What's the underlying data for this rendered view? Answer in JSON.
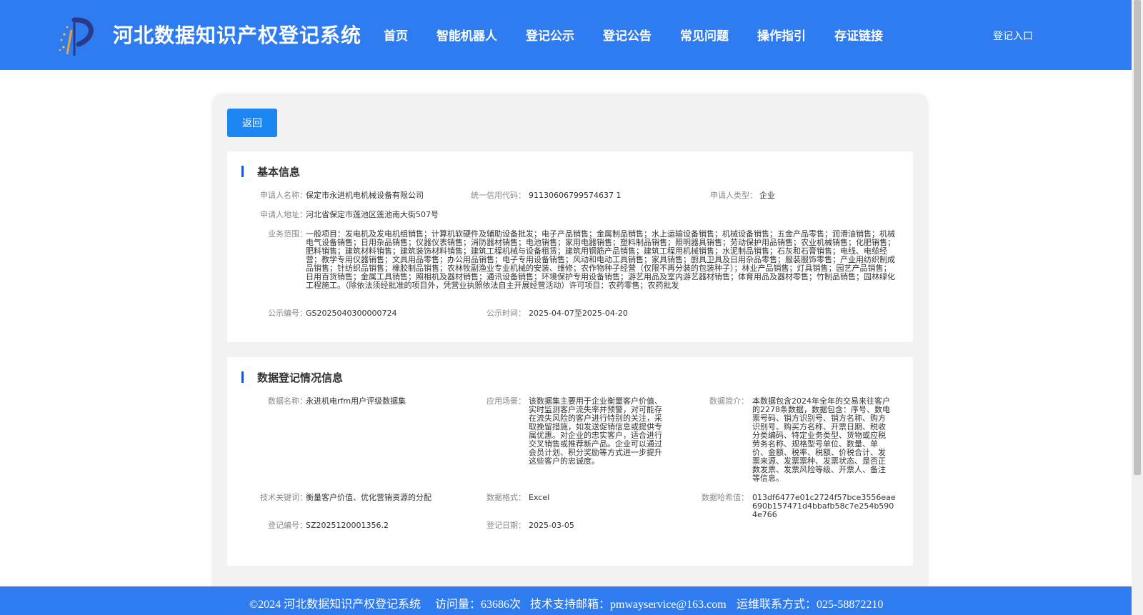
{
  "header": {
    "site_title": "河北数据知识产权登记系统",
    "nav": [
      "首页",
      "智能机器人",
      "登记公示",
      "登记公告",
      "常见问题",
      "操作指引",
      "存证链接"
    ],
    "login": "登记入口",
    "colors": {
      "header_bg": "#2f7bf0",
      "button": "#1e86f2",
      "section_accent": "#1e56c8"
    }
  },
  "toolbar": {
    "back_label": "返回"
  },
  "basic_info": {
    "title": "基本信息",
    "applicant_name": {
      "label": "申请人名称：",
      "value": "保定市永进机电机械设备有限公司"
    },
    "credit_code": {
      "label": "统一信用代码：",
      "value": "91130606799574637 1"
    },
    "applicant_type": {
      "label": "申请人类型：",
      "value": "企业"
    },
    "address": {
      "label": "申请人地址：",
      "value": "河北省保定市莲池区莲池南大街507号"
    },
    "business_scope": {
      "label": "业务范围：",
      "value": "一般项目：发电机及发电机组销售；计算机软硬件及辅助设备批发；电子产品销售；金属制品销售；水上运输设备销售；机械设备销售；五金产品零售；润滑油销售；机械电气设备销售；日用杂品销售；仪器仪表销售；消防器材销售；电池销售；家用电器销售；塑料制品销售；照明器具销售；劳动保护用品销售；农业机械销售；化肥销售；肥料销售；建筑材料销售；建筑装饰材料销售；建筑工程机械与设备租赁；建筑用钢筋产品销售；建筑工程用机械销售；水泥制品销售；石灰和石膏销售；电线、电缆经营；教学专用仪器销售；文具用品零售；办公用品销售；电子专用设备销售；风动和电动工具销售；家具销售；厨具卫具及日用杂品零售；服装服饰零售；产业用纺织制成品销售；针纺织品销售；橡胶制品销售；农林牧副渔业专业机械的安装、维修；农作物种子经营（仅限不再分装的包装种子）；林业产品销售；灯具销售；园艺产品销售；日用百货销售；金属工具销售；照相机及器材销售；通讯设备销售；环境保护专用设备销售；游艺用品及室内游艺器材销售；体育用品及器材零售；竹制品销售；园林绿化工程施工。（除依法须经批准的项目外，凭营业执照依法自主开展经营活动）许可项目：农药零售；农药批发"
    },
    "notice_no": {
      "label": "公示编号：",
      "value": "GS2025040300000724"
    },
    "notice_time": {
      "label": "公示时间：",
      "value": "2025-04-07至2025-04-20"
    }
  },
  "registration_info": {
    "title": "数据登记情况信息",
    "data_name": {
      "label": "数据名称：",
      "value": "永进机电rfm用户评级数据集"
    },
    "scenario": {
      "label": "应用场景：",
      "value": "该数据集主要用于企业衡量客户价值、实时监测客户流失率并预警，对可能存在流失风险的客户进行特别的关注，采取挽留措施，如发送促销信息或提供专属优惠。对企业的忠实客户，适合进行交叉销售或推荐新产品。企业可以通过会员计划、积分奖励等方式进一步提升这些客户的忠诚度。"
    },
    "summary": {
      "label": "数据简介：",
      "value": "本数据包含2024年全年的交易来往客户的2278条数据，数据包含：序号、数电票号码、销方识别号、销方名称、购方识别号、购买方名称、开票日期、税收分类编码、特定业务类型、货物或应税劳务名称、规格型号单位、数量、单价、金额、税率、税额、价税合计、发票来源、发票票种、发票状态、是否正数发票、发票风险等级、开票人、备注等信息。"
    },
    "keywords": {
      "label": "技术关键词：",
      "value": "衡量客户价值、优化营销资源的分配"
    },
    "format": {
      "label": "数据格式：",
      "value": "Excel"
    },
    "hash": {
      "label": "数据哈希值：",
      "value": "013df6477e01c2724f57bce3556eae690b157471d4bbafb58c7e254b5904e766"
    },
    "reg_no": {
      "label": "登记编号：",
      "value": "SZ2025120001356.2"
    },
    "reg_date": {
      "label": "登记日期：",
      "value": "2025-03-05"
    }
  },
  "footer": {
    "copyright": "©2024 河北数据知识产权登记系统",
    "visits": "访问量：63686次",
    "email": "技术支持邮箱：pmwayservice@163.com",
    "phone": "运维联系方式：025-58872210"
  }
}
